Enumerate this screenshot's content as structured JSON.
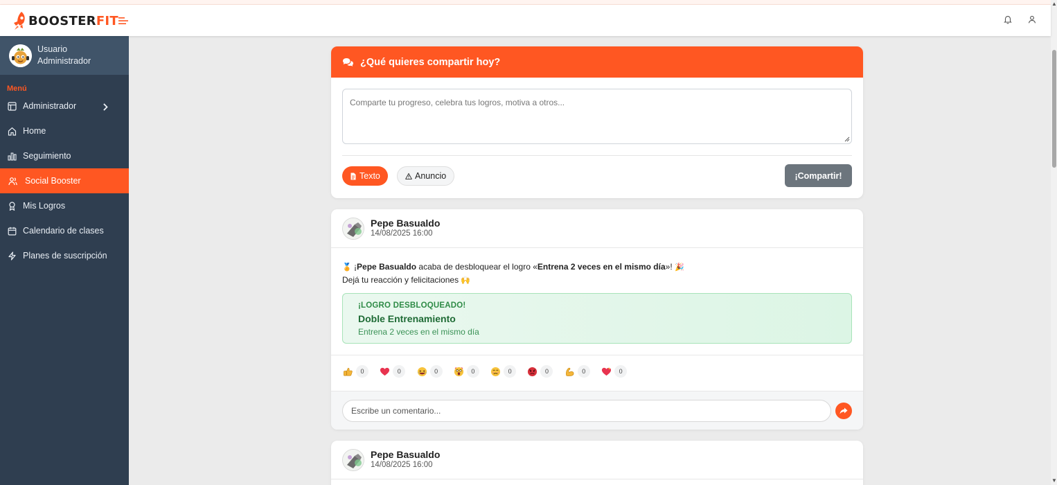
{
  "brand": {
    "name_part1": "BOOSTER",
    "name_part2": "FIT",
    "accent_color": "#ff5722"
  },
  "topbar": {
    "menu_toggle_icon": "menu-lines-icon",
    "icons": [
      "bell-icon",
      "user-icon"
    ]
  },
  "sidebar": {
    "user": {
      "line1": "Usuario",
      "line2": "Administrador"
    },
    "menu_header": "Menú",
    "items": [
      {
        "label": "Administrador",
        "icon": "layout-icon",
        "has_submenu": true
      },
      {
        "label": "Home",
        "icon": "home-icon"
      },
      {
        "label": "Seguimiento",
        "icon": "bar-chart-icon"
      },
      {
        "label": "Social Booster",
        "icon": "users-icon",
        "active": true
      },
      {
        "label": "Mis Logros",
        "icon": "award-icon"
      },
      {
        "label": "Calendario de clases",
        "icon": "calendar-icon"
      },
      {
        "label": "Planes de suscripción",
        "icon": "lightning-icon"
      }
    ]
  },
  "compose": {
    "title": "¿Qué quieres compartir hoy?",
    "placeholder": "Comparte tu progreso, celebra tus logros, motiva a otros...",
    "type_texto": "Texto",
    "type_anuncio": "Anuncio",
    "share_button": "¡Compartir!"
  },
  "posts": [
    {
      "author": "Pepe Basualdo",
      "date": "14/08/2025 16:00",
      "text_intro": "¡",
      "text_author": "Pepe Basualdo",
      "text_middle": " acaba de desbloquear el logro «",
      "text_achievement": "Entrena 2 veces en el mismo día",
      "text_end": "»! ",
      "text_line2": "Dejá tu reacción y felicitaciones ",
      "achievement": {
        "label": "¡LOGRO DESBLOQUEADO!",
        "title": "Doble Entrenamiento",
        "description": "Entrena 2 veces en el mismo día"
      },
      "reactions": [
        {
          "icon": "thumbs-up-icon",
          "count": "0"
        },
        {
          "icon": "heart-icon",
          "count": "0"
        },
        {
          "icon": "laughing-face-icon",
          "count": "0"
        },
        {
          "icon": "surprised-face-icon",
          "count": "0"
        },
        {
          "icon": "sad-face-icon",
          "count": "0"
        },
        {
          "icon": "angry-face-icon",
          "count": "0"
        },
        {
          "icon": "flexed-biceps-icon",
          "count": "0"
        },
        {
          "icon": "sparkling-heart-icon",
          "count": "0"
        }
      ],
      "comment_placeholder": "Escribe un comentario..."
    },
    {
      "author": "Pepe Basualdo",
      "date": "14/08/2025 16:00"
    }
  ]
}
